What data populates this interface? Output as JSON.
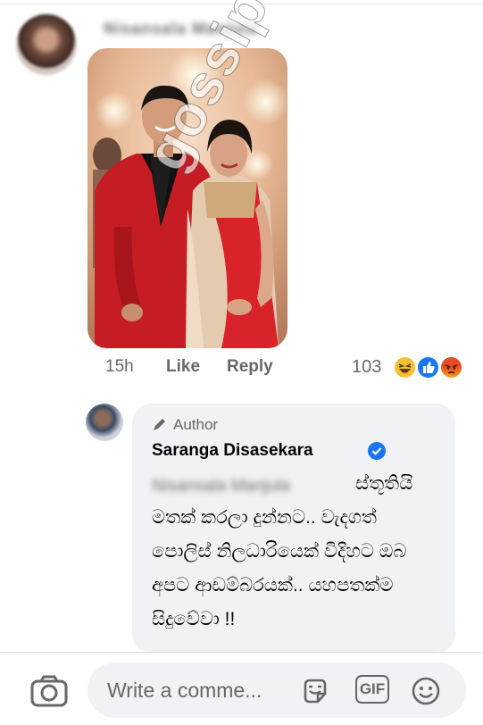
{
  "comment": {
    "author_blurred": "Nisansala Manjula",
    "time": "15h",
    "like_label": "Like",
    "reply_label": "Reply",
    "reaction_count": "103",
    "reactions": [
      "haha-icon",
      "like-icon",
      "angry-icon"
    ],
    "watermark": "gossip"
  },
  "reply": {
    "badge": "Author",
    "name": "Saranga Disasekara",
    "tag_blurred": "Nisansala Manjula",
    "lines": [
      "ස්තූතියි",
      "මතක් කරලා දුන්නට.. වැදගත්",
      "පොලිස් නිලධාරියෙක් විදිහට ඔබ",
      "අපට ආඩම්බරයක්.. යහපතක්ම",
      "සිදුවේවා !!"
    ]
  },
  "composer": {
    "placeholder": "Write a comme...",
    "gif_label": "GIF"
  },
  "colors": {
    "accent": "#1877f2",
    "bubble": "#f0f2f5",
    "muted": "#65676b"
  }
}
